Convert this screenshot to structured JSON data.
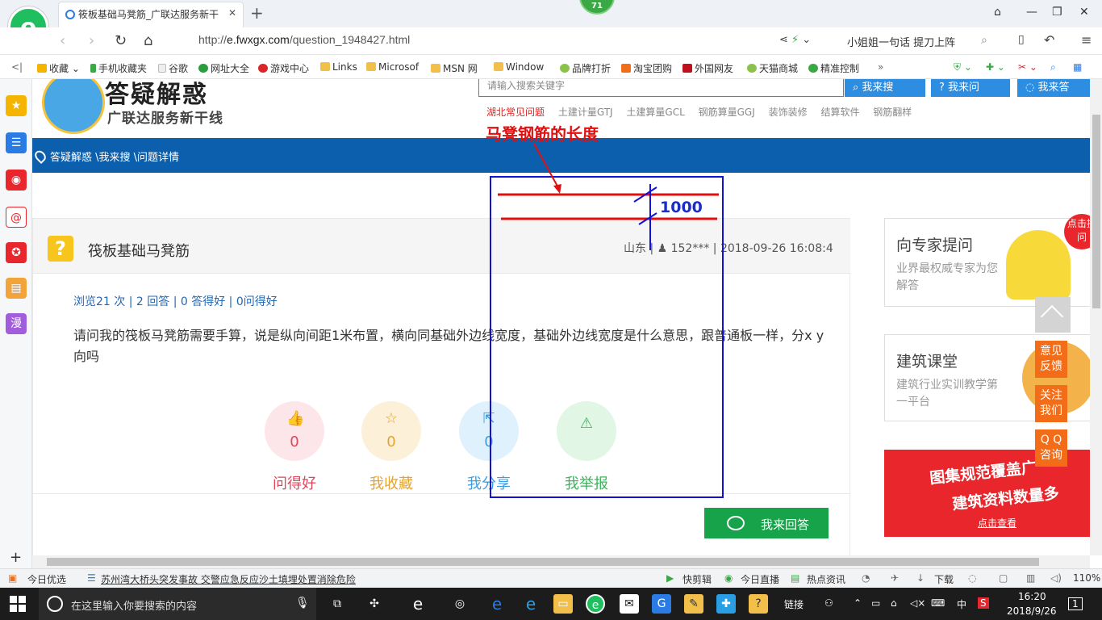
{
  "browser": {
    "tab_title": "筱板基础马凳筋_广联达服务新干",
    "tab_close": "✕",
    "new_tab": "+",
    "badge": "71",
    "url_prefix": "http://",
    "url_host": "e.fwxgx.com",
    "url_path": "/question_1948427.html",
    "slogan": "小姐姐一句话 提刀上阵"
  },
  "bookmarks": [
    {
      "label": "收藏",
      "color": "#f5b400"
    },
    {
      "label": "手机收藏夹",
      "color": "#3aa845"
    },
    {
      "label": "谷歌",
      "color": "#bbbbbb"
    },
    {
      "label": "网址大全",
      "color": "#2a9e3c"
    },
    {
      "label": "游戏中心",
      "color": "#d8262b"
    },
    {
      "label": "Links",
      "color": "#f2c04a"
    },
    {
      "label": "Microsof",
      "color": "#f2c04a"
    },
    {
      "label": "MSN 网",
      "color": "#f2c04a"
    },
    {
      "label": "Window",
      "color": "#f2c04a"
    },
    {
      "label": "品牌打折",
      "color": "#8bc34a"
    },
    {
      "label": "淘宝团购",
      "color": "#f36c17"
    },
    {
      "label": "外国网友",
      "color": "#c0111a"
    },
    {
      "label": "天猫商城",
      "color": "#8bc34a"
    },
    {
      "label": "精准控制",
      "color": "#3aa845"
    }
  ],
  "site": {
    "title": "答疑解惑",
    "subtitle": "广联达服务新干线",
    "search_placeholder": "请输入搜索关键字",
    "search_btn": "我来搜",
    "ask_btn": "我来问",
    "answer_top_btn": "我来答",
    "hotlinks": [
      "湖北常见问题",
      "土建计量GTJ",
      "土建算量GCL",
      "钢筋算量GGJ",
      "装饰装修",
      "结算软件",
      "钢筋翻样"
    ],
    "breadcrumb": "答疑解惑 \\我来搜 \\问题详情"
  },
  "question": {
    "title": "筏板基础马凳筋",
    "meta": "山东 | ♟ 152*** | 2018-09-26 16:08:4",
    "stats": "浏览21 次 | 2 回答 | 0 答得好 | 0问得好",
    "body": "请问我的筏板马凳筋需要手算，说是纵向间距1米布置，横向同基础外边线宽度，基础外边线宽度是什么意思，跟普通板一样，分x y向吗",
    "actions": [
      {
        "label": "问得好",
        "count": "0",
        "icon": "👍",
        "bg": "#fde6ea",
        "fg": "#e0445a"
      },
      {
        "label": "我收藏",
        "count": "0",
        "icon": "☆",
        "bg": "#fdf0d9",
        "fg": "#e3a332"
      },
      {
        "label": "我分享",
        "count": "0",
        "icon": "⇱",
        "bg": "#dff1fc",
        "fg": "#3c9ee0"
      },
      {
        "label": "我举报",
        "count": "",
        "icon": "⚠",
        "bg": "#e1f6e4",
        "fg": "#3cb35a"
      }
    ],
    "answer_btn": "我来回答"
  },
  "sidebar_right": {
    "expert_title": "向专家提问",
    "expert_desc": "业界最权威专家为您解答",
    "expert_tag": "点击提问",
    "course_title": "建筑课堂",
    "course_desc": "建筑行业实训教学第一平台",
    "banner_line1": "图集规范覆盖广",
    "banner_line2": "建筑资料数量多",
    "banner_cta": "点击查看",
    "float_btns": [
      "意见反馈",
      "关注我们",
      "Q Q咨询"
    ]
  },
  "annotation": {
    "title": "马凳钢筋的长度",
    "number": "1000"
  },
  "newsbar": {
    "left": "今日优选",
    "headline": "苏州湾大桥头突发事故 交警应急反应沙土填埋处置消除危险",
    "items": [
      "快剪辑",
      "今日直播",
      "热点资讯",
      "下载"
    ],
    "zoom": "110%"
  },
  "taskbar": {
    "search_text": "在这里输入你要搜索的内容",
    "links_label": "链接",
    "ime": "中",
    "time": "16:20",
    "date": "2018/9/26",
    "notif_count": "1"
  }
}
